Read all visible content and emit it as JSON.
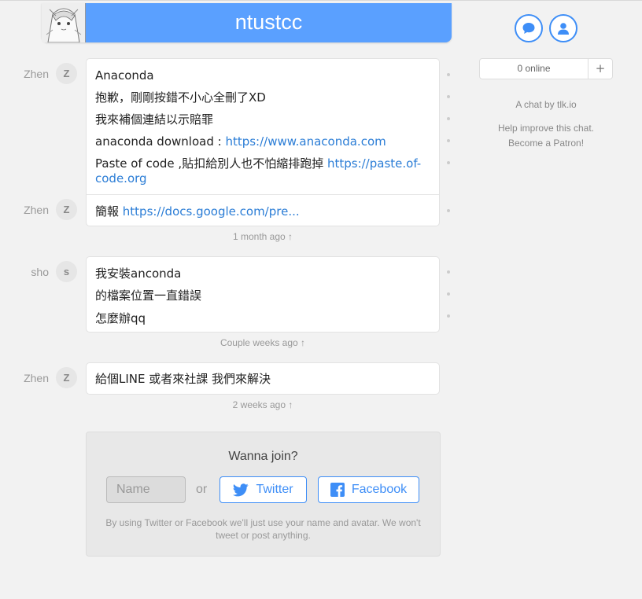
{
  "header": {
    "title": "ntustcc",
    "avatar_icon": "anime-avatar-icon"
  },
  "top_buttons": {
    "chat_icon": "chat-bubble-icon",
    "user_icon": "user-icon"
  },
  "sidebar": {
    "online_count": "0 online",
    "plus_label": "+",
    "credit": "A chat by tlk.io",
    "help_line1": "Help improve this chat.",
    "help_line2": "Become a Patron!"
  },
  "groups": [
    {
      "author": "Zhen",
      "initial": "Z",
      "messages": [
        {
          "text": "Anaconda"
        },
        {
          "text": "抱歉，剛剛按錯不小心全刪了XD"
        },
        {
          "text": "我來補個連結以示賠罪"
        },
        {
          "text": "anaconda download : ",
          "link": "https://www.anaconda.com"
        },
        {
          "text": "Paste of code ,貼扣給別人也不怕縮排跑掉 ",
          "link": "https://paste.of-code.org"
        }
      ]
    },
    {
      "author": "Zhen",
      "initial": "Z",
      "messages": [
        {
          "text": "簡報 ",
          "link": "https://docs.google.com/pre..."
        }
      ],
      "time": "1 month ago ↑"
    },
    {
      "author": "sho",
      "initial": "s",
      "messages": [
        {
          "text": "我安裝anconda"
        },
        {
          "text": "的檔案位置一直錯誤"
        },
        {
          "text": "怎麼辦qq"
        }
      ],
      "time": "Couple weeks ago ↑"
    },
    {
      "author": "Zhen",
      "initial": "Z",
      "messages": [
        {
          "text": "給個LINE 或者來社課 我們來解決"
        }
      ],
      "time": "2 weeks ago ↑"
    }
  ],
  "join": {
    "heading": "Wanna join?",
    "name_placeholder": "Name",
    "or_label": "or",
    "twitter_label": "Twitter",
    "facebook_label": "Facebook",
    "note": "By using Twitter or Facebook we'll just use your name and avatar. We won't tweet or post anything."
  },
  "colors": {
    "accent": "#3e8ef7",
    "header_bg": "#5aa0ff",
    "link": "#2b7dd6",
    "background": "#f2f2f2"
  }
}
